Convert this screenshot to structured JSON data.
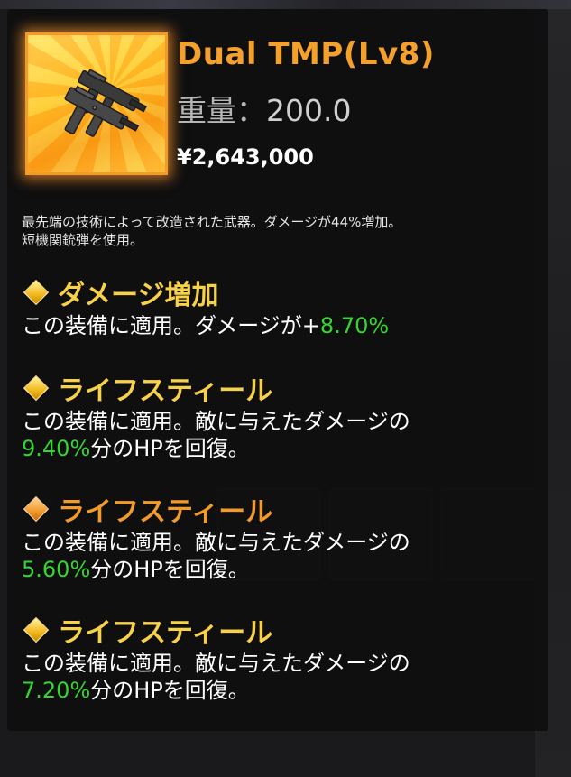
{
  "item": {
    "name": "Dual TMP(Lv8)",
    "weight_label": "重量：",
    "weight_value": "200.0",
    "price": "¥2,643,000",
    "icon": "submachine-gun-icon",
    "description_line1": "最先端の技術によって改造された武器。ダメージが44%増加。",
    "description_line2": "短機関銃弾を使用。"
  },
  "effects": [
    {
      "title": "ダメージ増加",
      "color": "#f7d149",
      "line1_pre": "この装備に適用。ダメージが+",
      "line1_value": "8.70%"
    },
    {
      "title": "ライフスティール",
      "color": "#f7d149",
      "line1": "この装備に適用。敵に与えたダメージの",
      "line2_value": "9.40%",
      "line2_post": "分のHPを回復。"
    },
    {
      "title": "ライフスティール",
      "color": "#f39a2b",
      "line1": "この装備に適用。敵に与えたダメージの",
      "line2_value": "5.60%",
      "line2_post": "分のHPを回復。"
    },
    {
      "title": "ライフスティール",
      "color": "#f7d149",
      "line1": "この装備に適用。敵に与えたダメージの",
      "line2_value": "7.20%",
      "line2_post": "分のHPを回復。"
    }
  ],
  "colors": {
    "name": "#f4a02c",
    "value_green": "#35d631",
    "panel_bg": "#0e0e10"
  }
}
